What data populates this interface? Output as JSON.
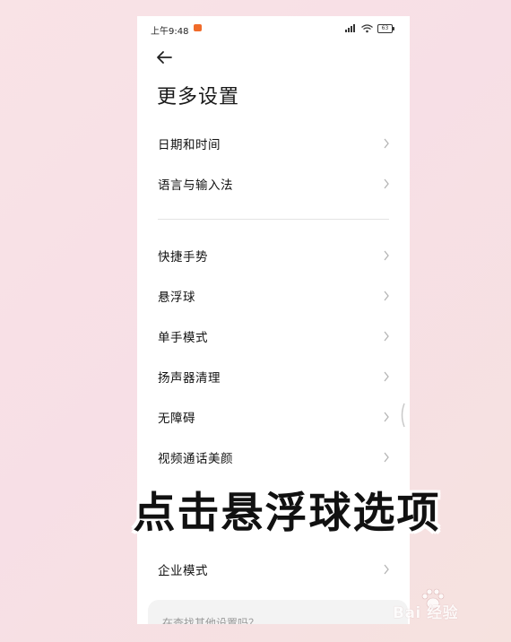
{
  "status_bar": {
    "time": "上午9:48",
    "battery": "63"
  },
  "page": {
    "title": "更多设置"
  },
  "group1": [
    {
      "label": "日期和时间"
    },
    {
      "label": "语言与输入法"
    }
  ],
  "group2": [
    {
      "label": "快捷手势"
    },
    {
      "label": "悬浮球"
    },
    {
      "label": "单手模式"
    },
    {
      "label": "扬声器清理"
    },
    {
      "label": "无障碍"
    },
    {
      "label": "视频通话美颜"
    }
  ],
  "group3": [
    {
      "label": "企业模式"
    }
  ],
  "search_card": {
    "text": "在查找其他设置吗？"
  },
  "overlay": {
    "caption": "点击悬浮球选项"
  },
  "watermark": {
    "text": "Bai 经验"
  },
  "colors": {
    "background": "#f8e2e5",
    "panel": "#ffffff",
    "text": "#111111",
    "chevron": "#b5b5b5",
    "accent_app_icon": "#f06b2a"
  }
}
